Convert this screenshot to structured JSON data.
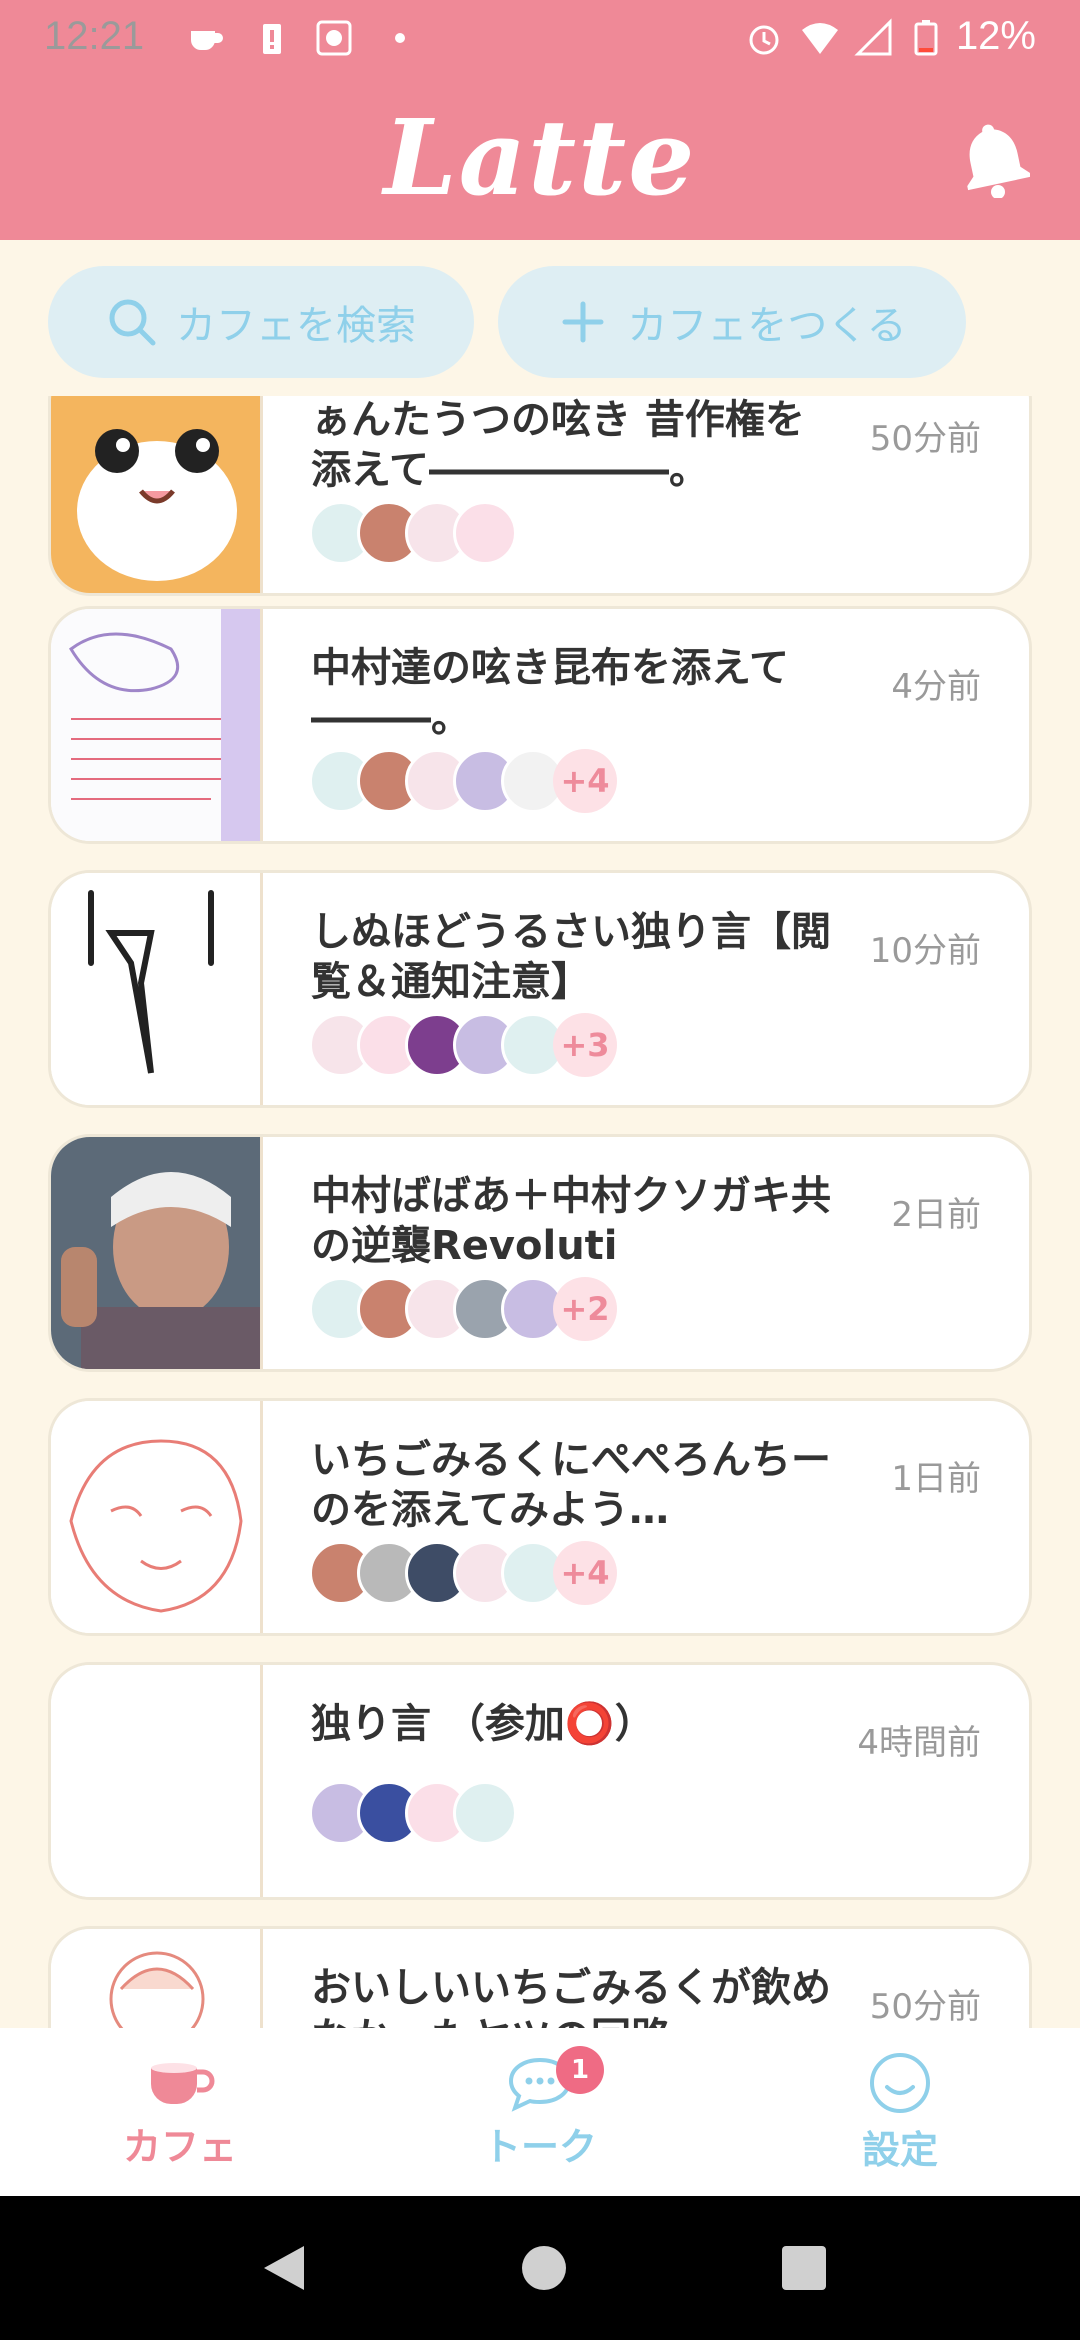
{
  "status": {
    "time": "12:21",
    "battery": "12%",
    "icons": [
      "coffee-cup-icon",
      "battery-alert-icon",
      "gallery-icon",
      "dot-icon",
      "alarm-icon",
      "wifi-icon",
      "signal-icon",
      "battery-icon"
    ]
  },
  "header": {
    "logo": "Latte",
    "bell_icon": "bell-icon"
  },
  "actions": {
    "search_label": "カフェを検索",
    "create_label": "カフェをつくる"
  },
  "cafes": [
    {
      "title": "ぁんたうつの呟き 昔作権を添えて――――――。",
      "time": "50分前",
      "extra": ""
    },
    {
      "title": "中村達の呟き昆布を添えて―――。",
      "time": "4分前",
      "extra": "+4"
    },
    {
      "title": "しぬほどうるさい独り言【閲覧＆通知注意】",
      "time": "10分前",
      "extra": "+3"
    },
    {
      "title": "中村ばばあ＋中村クソガキ共の逆襲Revoluti",
      "time": "2日前",
      "extra": "+2"
    },
    {
      "title": "いちごみるくにぺぺろんちーのを添えてみよう…",
      "time": "1日前",
      "extra": "+4"
    },
    {
      "title": "独り言 （参加⭕️）",
      "time": "4時間前",
      "extra": ""
    },
    {
      "title": "おいしいいちごみるくが飲めなかったヤツの回路",
      "time": "50分前",
      "extra": ""
    }
  ],
  "tabs": [
    {
      "label": "カフェ",
      "icon": "cafe-cup-icon"
    },
    {
      "label": "トーク",
      "icon": "chat-bubble-icon",
      "badge": "1"
    },
    {
      "label": "設定",
      "icon": "smile-face-icon"
    }
  ],
  "sysnav": [
    "back-icon",
    "home-icon",
    "recents-icon"
  ],
  "colors": {
    "header": "#ef8997",
    "background": "#fdf6e7",
    "accent_blue": "#8fd0ea",
    "badge": "#ef6b84"
  }
}
